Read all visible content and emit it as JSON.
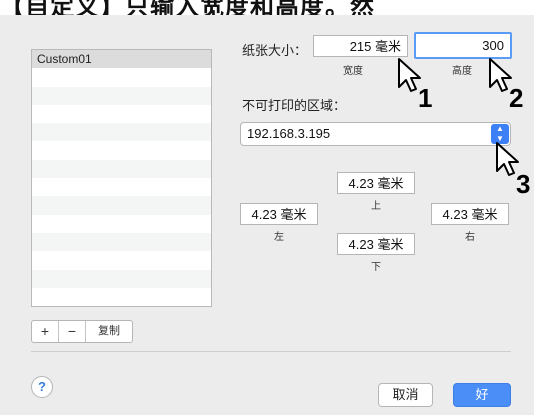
{
  "top_instruction": "【自定义】只输入宽度和高度。然",
  "list": {
    "items": [
      "Custom01"
    ]
  },
  "list_buttons": {
    "add": "+",
    "remove": "−",
    "duplicate": "复制"
  },
  "paper_size": {
    "label": "纸张大小：",
    "width_value": "215 毫米",
    "height_value": "300",
    "width_label": "宽度",
    "height_label": "高度"
  },
  "unprintable": {
    "label": "不可打印的区域：",
    "printer": "192.168.3.195"
  },
  "margins": {
    "top_value": "4.23 毫米",
    "top_label": "上",
    "left_value": "4.23 毫米",
    "left_label": "左",
    "right_value": "4.23 毫米",
    "right_label": "右",
    "bottom_value": "4.23 毫米",
    "bottom_label": "下"
  },
  "buttons": {
    "help": "?",
    "cancel": "取消",
    "ok": "好"
  },
  "callouts": [
    "1",
    "2",
    "3"
  ]
}
